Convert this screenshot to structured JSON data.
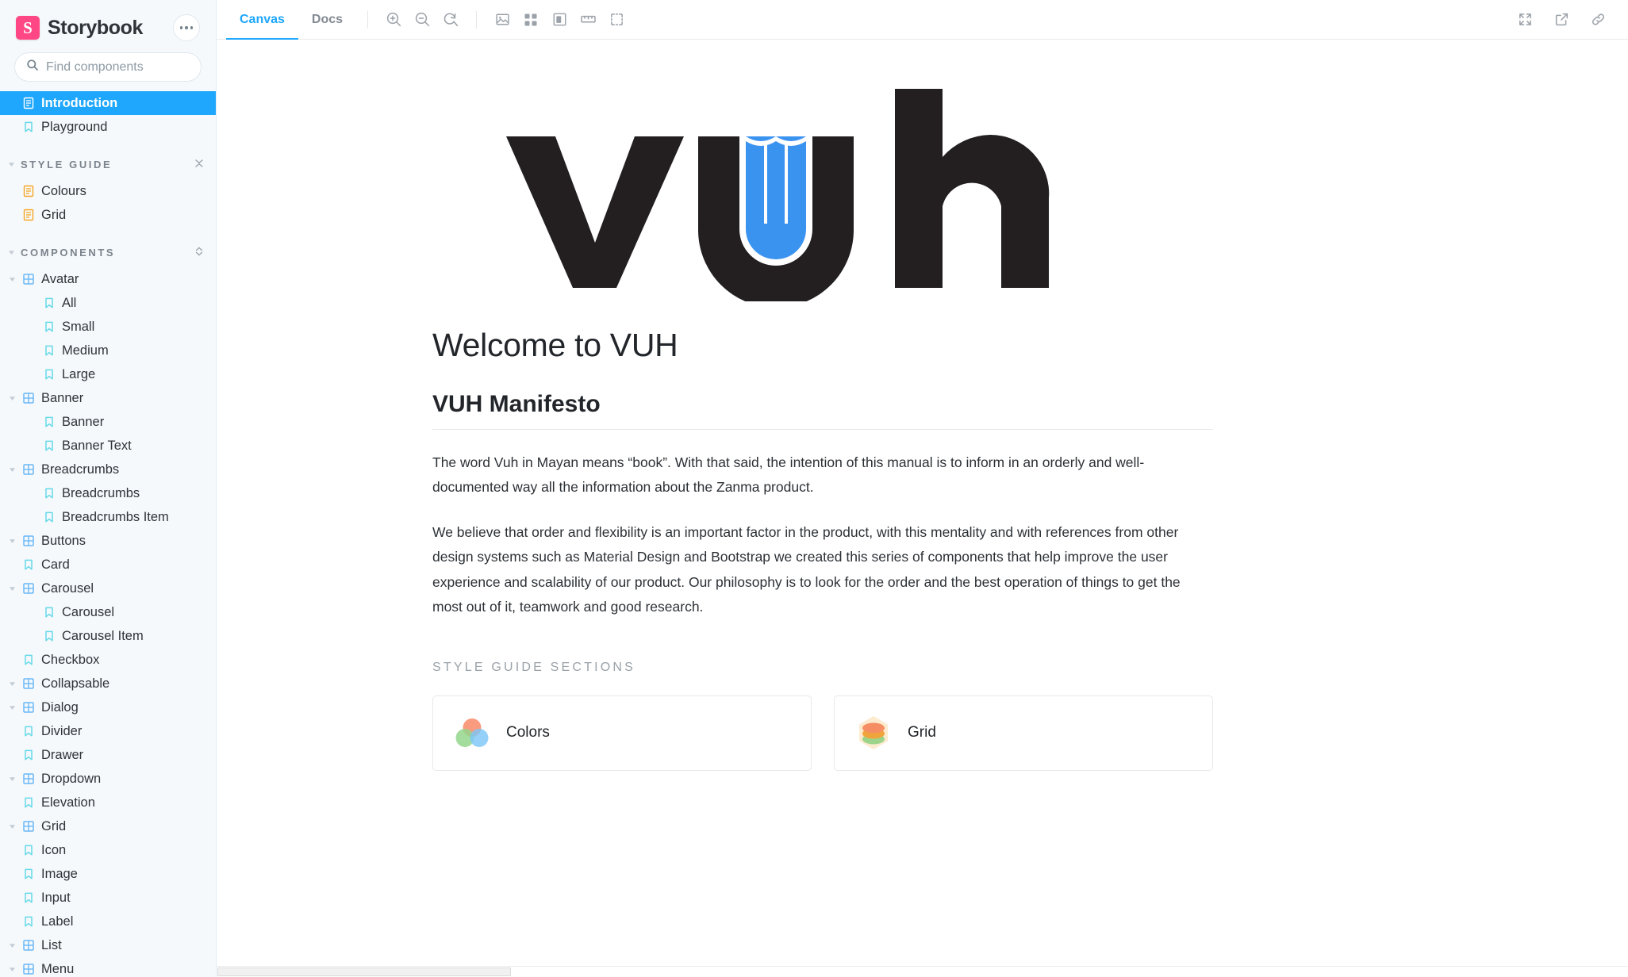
{
  "sidebar": {
    "brand": "Storybook",
    "logo_letter": "S",
    "logo_color": "#FF4785",
    "menu_button": "more-options",
    "search": {
      "placeholder": "Find components",
      "value": "",
      "shortcut": "/"
    },
    "top_items": [
      {
        "label": "Introduction",
        "icon": "document-icon",
        "selected": true,
        "level": 0
      },
      {
        "label": "Playground",
        "icon": "bookmark-icon",
        "selected": false,
        "level": 0
      }
    ],
    "sections": [
      {
        "label": "STYLE GUIDE",
        "toggle_icon": "collapse-all-icon",
        "items": [
          {
            "label": "Colours",
            "icon": "document-orange-icon",
            "level": 1
          },
          {
            "label": "Grid",
            "icon": "document-orange-icon",
            "level": 1
          }
        ]
      },
      {
        "label": "COMPONENTS",
        "toggle_icon": "expand-all-icon",
        "items": [
          {
            "label": "Avatar",
            "icon": "component-icon",
            "level": 1,
            "expandable": true
          },
          {
            "label": "All",
            "icon": "bookmark-icon",
            "level": 2
          },
          {
            "label": "Small",
            "icon": "bookmark-icon",
            "level": 2
          },
          {
            "label": "Medium",
            "icon": "bookmark-icon",
            "level": 2
          },
          {
            "label": "Large",
            "icon": "bookmark-icon",
            "level": 2
          },
          {
            "label": "Banner",
            "icon": "component-icon",
            "level": 1,
            "expandable": true
          },
          {
            "label": "Banner",
            "icon": "bookmark-icon",
            "level": 2
          },
          {
            "label": "Banner Text",
            "icon": "bookmark-icon",
            "level": 2
          },
          {
            "label": "Breadcrumbs",
            "icon": "component-icon",
            "level": 1,
            "expandable": true
          },
          {
            "label": "Breadcrumbs",
            "icon": "bookmark-icon",
            "level": 2
          },
          {
            "label": "Breadcrumbs Item",
            "icon": "bookmark-icon",
            "level": 2
          },
          {
            "label": "Buttons",
            "icon": "component-icon",
            "level": 1,
            "expandable": true
          },
          {
            "label": "Card",
            "icon": "bookmark-icon",
            "level": 1
          },
          {
            "label": "Carousel",
            "icon": "component-icon",
            "level": 1,
            "expandable": true
          },
          {
            "label": "Carousel",
            "icon": "bookmark-icon",
            "level": 2
          },
          {
            "label": "Carousel Item",
            "icon": "bookmark-icon",
            "level": 2
          },
          {
            "label": "Checkbox",
            "icon": "bookmark-icon",
            "level": 1
          },
          {
            "label": "Collapsable",
            "icon": "component-icon",
            "level": 1,
            "expandable": true
          },
          {
            "label": "Dialog",
            "icon": "component-icon",
            "level": 1,
            "expandable": true
          },
          {
            "label": "Divider",
            "icon": "bookmark-icon",
            "level": 1
          },
          {
            "label": "Drawer",
            "icon": "bookmark-icon",
            "level": 1
          },
          {
            "label": "Dropdown",
            "icon": "component-icon",
            "level": 1,
            "expandable": true
          },
          {
            "label": "Elevation",
            "icon": "bookmark-icon",
            "level": 1
          },
          {
            "label": "Grid",
            "icon": "component-icon",
            "level": 1,
            "expandable": true
          },
          {
            "label": "Icon",
            "icon": "bookmark-icon",
            "level": 1
          },
          {
            "label": "Image",
            "icon": "bookmark-icon",
            "level": 1
          },
          {
            "label": "Input",
            "icon": "bookmark-icon",
            "level": 1
          },
          {
            "label": "Label",
            "icon": "bookmark-icon",
            "level": 1
          },
          {
            "label": "List",
            "icon": "component-icon",
            "level": 1,
            "expandable": true
          },
          {
            "label": "Menu",
            "icon": "component-icon",
            "level": 1,
            "expandable": true
          }
        ]
      }
    ]
  },
  "toolbar": {
    "tabs": [
      {
        "label": "Canvas",
        "active": true
      },
      {
        "label": "Docs",
        "active": false
      }
    ],
    "zoom_in": "zoom-in-icon",
    "zoom_out": "zoom-out-icon",
    "zoom_reset": "zoom-reset-icon",
    "background": "background-image-icon",
    "grid": "grid-icon",
    "outline": "outline-icon",
    "measure": "measure-ruler-icon",
    "focus": "selection-box-icon",
    "fullscreen": "fullscreen-icon",
    "open_new_tab": "open-external-icon",
    "copy_link": "link-icon",
    "accent_color": "#1EA7FD"
  },
  "content": {
    "logo_alt": "vuh",
    "logo_text": "vuh",
    "logo_color": "#231F20",
    "logo_accent_color": "#3B93F0",
    "heading": "Welcome to VUH",
    "subheading": "VUH Manifesto",
    "paragraphs": [
      "The word Vuh in Mayan means “book”. With that said, the intention of this manual is to inform in an orderly and well-documented way all the information about the Zanma product.",
      "We believe that order and flexibility is an important factor in the product, with this mentality and with references from other design systems such as Material Design and Bootstrap we created this series of components that help improve the user experience and scalability of our product. Our philosophy is to look for the order and the best operation of things to get the most out of it, teamwork and good research."
    ],
    "sections_label": "STYLE GUIDE SECTIONS",
    "cards": [
      {
        "label": "Colors",
        "icon": "color-circles-icon"
      },
      {
        "label": "Grid",
        "icon": "layers-stack-icon"
      }
    ]
  }
}
